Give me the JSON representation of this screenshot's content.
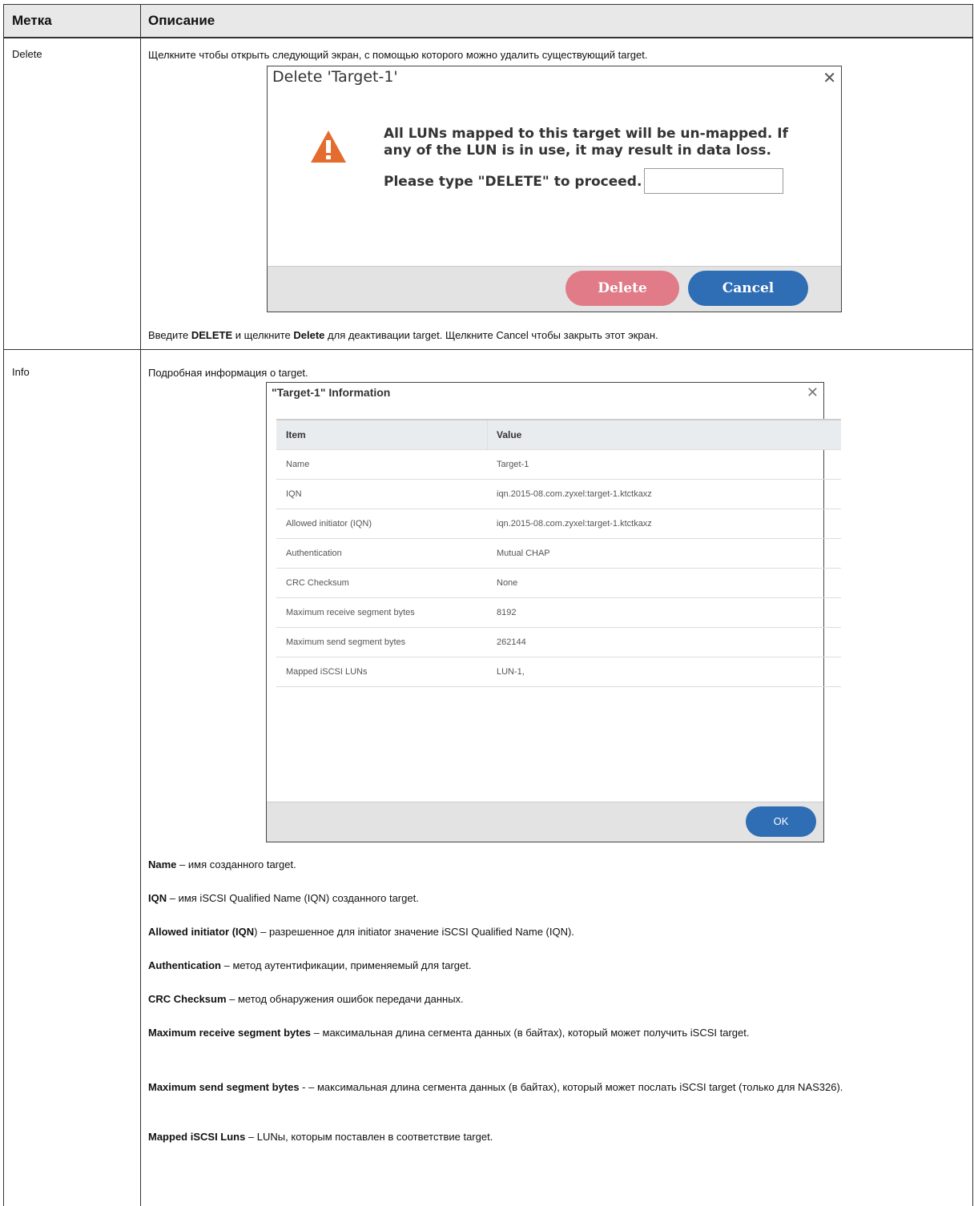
{
  "header": {
    "label_col": "Метка",
    "desc_col": "Описание"
  },
  "rows": [
    {
      "label": "Delete",
      "intro": "Щелкните чтобы открыть следующий экран, с помощью которого можно удалить существующий target.",
      "footer_pre": "Введите ",
      "footer_bold1": "DELETE",
      "footer_mid": " и щелкните ",
      "footer_bold2": "Delete",
      "footer_post": " для деактивации target. Щелкните Cancel чтобы закрыть этот экран."
    },
    {
      "label": "Info",
      "intro": "Подробная информация о target."
    }
  ],
  "delete_dialog": {
    "title": "Delete 'Target-1'",
    "close": "✕",
    "message": "All LUNs mapped to this target will be un-mapped. If any of the LUN is in use, it may result in data loss.",
    "prompt": "Please type \"DELETE\" to proceed.",
    "input_value": "",
    "delete_label": "Delete",
    "cancel_label": "Cancel",
    "colors": {
      "delete": "#e07b87",
      "cancel": "#2f6db4",
      "warning": "#e36c2e"
    }
  },
  "info_dialog": {
    "title": "\"Target-1\" Information",
    "close": "✕",
    "columns": [
      "Item",
      "Value"
    ],
    "rows": [
      [
        "Name",
        "Target-1"
      ],
      [
        "IQN",
        "iqn.2015-08.com.zyxel:target-1.ktctkaxz"
      ],
      [
        "Allowed initiator (IQN)",
        "iqn.2015-08.com.zyxel:target-1.ktctkaxz"
      ],
      [
        "Authentication",
        "Mutual CHAP"
      ],
      [
        "CRC Checksum",
        "None"
      ],
      [
        "Maximum receive segment bytes",
        "8192"
      ],
      [
        "Maximum send segment bytes",
        "262144"
      ],
      [
        "Mapped iSCSI LUNs",
        "LUN-1,"
      ]
    ],
    "ok_label": "OK"
  },
  "descriptions": [
    {
      "term": "Name",
      "text": " – имя созданного target."
    },
    {
      "term": "IQN",
      "text": " – имя iSCSI Qualified Name (IQN) созданного target."
    },
    {
      "term": "Allowed initiator (IQN",
      "text": ") – разрешенное для initiator значение iSCSI Qualified Name (IQN)."
    },
    {
      "term": "Authentication",
      "text": " – метод аутентификации, применяемый для target."
    },
    {
      "term": "CRC Checksum",
      "text": " – метод обнаружения ошибок передачи данных."
    },
    {
      "term": "Maximum receive segment bytes",
      "text": " – максимальная длина сегмента данных (в байтах), который может получить iSCSI target."
    },
    {
      "term": "Maximum send segment bytes",
      "text": " - – максимальная длина сегмента данных (в байтах), который может послать iSCSI target (только для NAS326)."
    },
    {
      "term": "Mapped iSCSI Luns",
      "text": " – LUNы, которым поставлен в соответствие target."
    }
  ]
}
